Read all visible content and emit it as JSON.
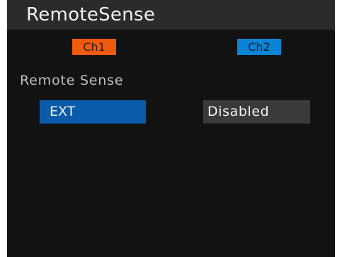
{
  "title": "RemoteSense",
  "channels": [
    {
      "label": "Ch1",
      "color": "#f15a0a"
    },
    {
      "label": "Ch2",
      "color": "#0a84d6"
    }
  ],
  "section_label": "Remote Sense",
  "values": [
    {
      "channel": "Ch1",
      "value": "EXT",
      "selected": true
    },
    {
      "channel": "Ch2",
      "value": "Disabled",
      "selected": false
    }
  ]
}
